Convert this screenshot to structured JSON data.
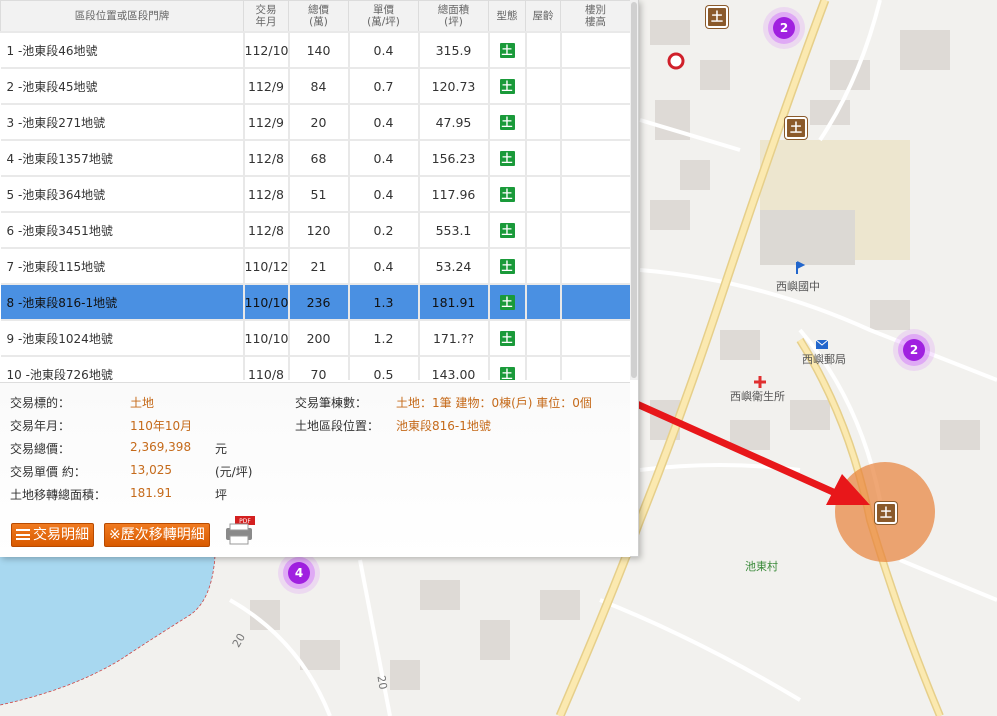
{
  "table": {
    "headers": [
      "區段位置或區段門牌",
      "交易\n年月",
      "總價\n(萬)",
      "單價\n(萬/坪)",
      "總面積\n(坪)",
      "型態",
      "屋齡",
      "樓別\n樓高"
    ],
    "rows": [
      {
        "addr": "1 -池東段46地號",
        "ym": "112/10",
        "total": "140",
        "unit": "0.4",
        "area": "315.9"
      },
      {
        "addr": "2 -池東段45地號",
        "ym": "112/9",
        "total": "84",
        "unit": "0.7",
        "area": "120.73"
      },
      {
        "addr": "3 -池東段271地號",
        "ym": "112/9",
        "total": "20",
        "unit": "0.4",
        "area": "47.95"
      },
      {
        "addr": "4 -池東段1357地號",
        "ym": "112/8",
        "total": "68",
        "unit": "0.4",
        "area": "156.23"
      },
      {
        "addr": "5 -池東段364地號",
        "ym": "112/8",
        "total": "51",
        "unit": "0.4",
        "area": "117.96"
      },
      {
        "addr": "6 -池東段3451地號",
        "ym": "112/8",
        "total": "120",
        "unit": "0.2",
        "area": "553.1"
      },
      {
        "addr": "7 -池東段115地號",
        "ym": "110/12",
        "total": "21",
        "unit": "0.4",
        "area": "53.24"
      },
      {
        "addr": "8 -池東段816-1地號",
        "ym": "110/10",
        "total": "236",
        "unit": "1.3",
        "area": "181.91"
      },
      {
        "addr": "9 -池東段1024地號",
        "ym": "110/10",
        "total": "200",
        "unit": "1.2",
        "area": "171.??"
      },
      {
        "addr": "10 -池東段726地號",
        "ym": "110/8",
        "total": "70",
        "unit": "0.5",
        "area": "143.00"
      }
    ],
    "type_icon_char": "土",
    "selected_index": 7
  },
  "detail": {
    "target_label": "交易標的：",
    "target_value": "土地",
    "ym_label": "交易年月：",
    "ym_value": "110年10月",
    "total_label": "交易總價：",
    "total_value": "2,369,398",
    "total_unit": "元",
    "unitprice_label": "交易單價 約：",
    "unitprice_value": "13,025",
    "unitprice_unit": "(元/坪)",
    "area_label": "土地移轉總面積：",
    "area_value": "181.91",
    "area_unit": "坪",
    "count_label": "交易筆棟數：",
    "count_value": "土地：1筆 建物：0棟(戶) 車位：0個",
    "loc_label": "土地區段位置：",
    "loc_value": "池東段816-1地號"
  },
  "buttons": {
    "detail_label": "交易明細",
    "history_label": "※歷次移轉明細",
    "pdf_badge": "PDF"
  },
  "map": {
    "labels": {
      "school": "西嶼國中",
      "post": "西嶼郵局",
      "clinic": "西嶼衛生所",
      "village": "池東村",
      "road1": "20",
      "road2": "20"
    },
    "clusters": [
      "2",
      "2",
      "4"
    ],
    "land_char": "土"
  },
  "colors": {
    "selected_row": "#4a90e2",
    "accent_orange": "#e8731a",
    "value_text": "#c56a1a",
    "arrow": "#e8171a",
    "land_icon": "#1a9a3a",
    "cluster": "#a020e0"
  }
}
